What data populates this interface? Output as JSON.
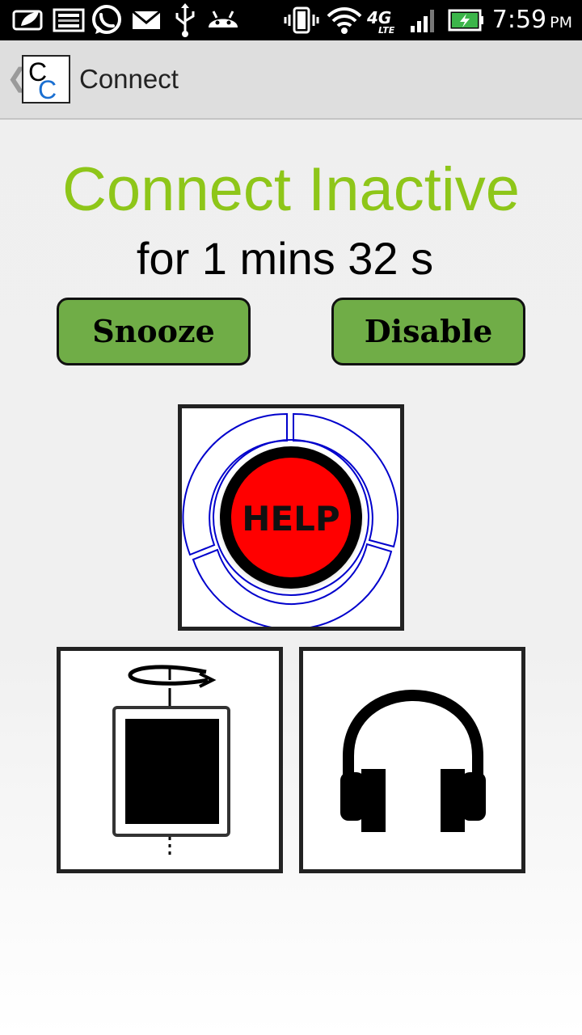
{
  "status_bar": {
    "time": "7:59",
    "ampm": "PM",
    "network_label": "4G",
    "network_sub": "LTE",
    "icons": [
      "leaf-notification-icon",
      "image-notification-icon",
      "whatsapp-icon",
      "email-icon",
      "usb-icon",
      "android-icon",
      "vibrate-icon",
      "wifi-icon",
      "4g-lte-icon",
      "signal-icon",
      "battery-charging-icon"
    ]
  },
  "action_bar": {
    "title": "Connect",
    "logo_letters": [
      "C",
      "C"
    ],
    "icons": [
      "back-chevron-icon",
      "app-logo-icon"
    ]
  },
  "main": {
    "status_heading": "Connect Inactive",
    "status_detail": "for 1 mins 32 s",
    "snooze_label": "Snooze",
    "disable_label": "Disable",
    "help_label": "HELP",
    "tiles": [
      "help-button-icon",
      "screen-rotate-icon",
      "headphones-icon"
    ]
  },
  "colors": {
    "accent_green": "#8ec619",
    "button_green": "#70ad47",
    "help_red": "#ff0000",
    "ring_blue": "#0000cc",
    "logo_blue": "#1a6fd1"
  }
}
